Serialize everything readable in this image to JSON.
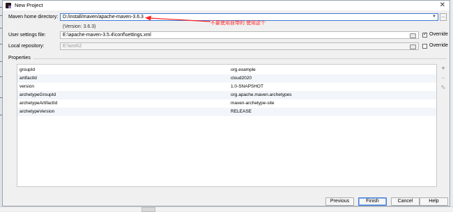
{
  "dialog": {
    "title": "New Project"
  },
  "maven_home": {
    "label": "Maven home directory:",
    "value": "D:/install/maven/apache-maven-3.6.3",
    "version_note": "(Version: 3.6.3)",
    "more_button": "..."
  },
  "annotation": "不要使用自带的  使用这个",
  "user_settings": {
    "label": "User settings file:",
    "value": "E:\\apache-maven-3.5.4\\conf\\settings.xml",
    "override_label": "Override",
    "override_checked": true
  },
  "local_repo": {
    "label": "Local repository:",
    "value": "E:\\work2",
    "override_label": "Override",
    "override_checked": false
  },
  "properties": {
    "title": "Properties",
    "rows": [
      {
        "key": "groupId",
        "value": "org.example"
      },
      {
        "key": "artifactId",
        "value": "cloud2020"
      },
      {
        "key": "version",
        "value": "1.0-SNAPSHOT"
      },
      {
        "key": "archetypeGroupId",
        "value": "org.apache.maven.archetypes"
      },
      {
        "key": "archetypeArtifactId",
        "value": "maven-archetype-site"
      },
      {
        "key": "archetypeVersion",
        "value": "RELEASE"
      }
    ],
    "tools": {
      "add": "+",
      "remove": "−"
    }
  },
  "buttons": {
    "previous": "Previous",
    "finish": "Finish",
    "cancel": "Cancel",
    "help": "Help"
  },
  "colors": {
    "accent": "#3d7bd9",
    "annotation": "#ff2020"
  }
}
